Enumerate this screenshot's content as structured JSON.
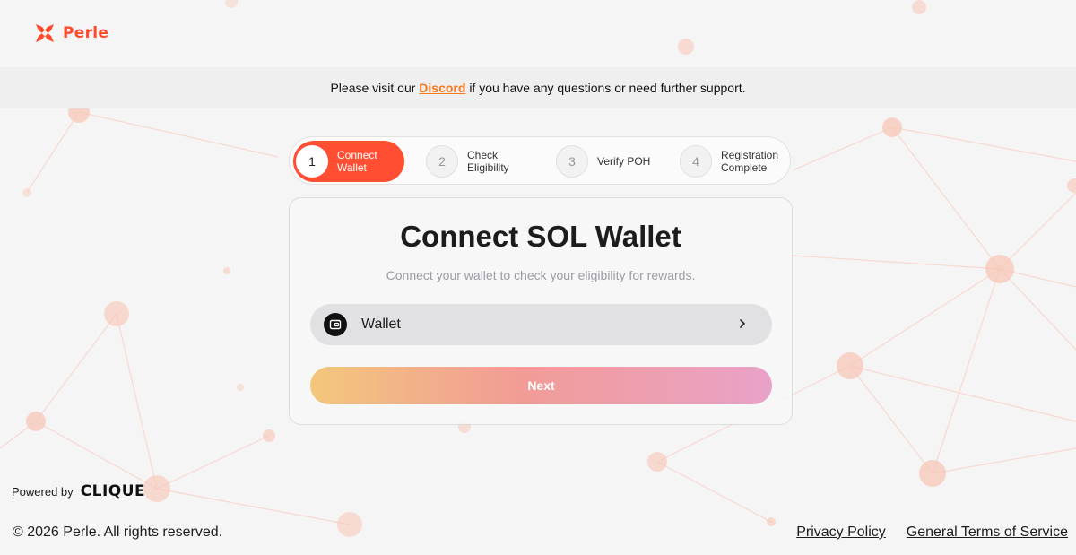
{
  "brand": {
    "name": "Perle",
    "color": "#ff4b2b"
  },
  "banner": {
    "prefix": "Please visit our",
    "link_label": "Discord",
    "suffix": "if you have any questions or need further support."
  },
  "steps": [
    {
      "number": "1",
      "label": "Connect\nWallet",
      "active": true
    },
    {
      "number": "2",
      "label": "Check\nEligibility",
      "active": false
    },
    {
      "number": "3",
      "label": "Verify POH",
      "active": false
    },
    {
      "number": "4",
      "label": "Registration\nComplete",
      "active": false
    }
  ],
  "card": {
    "title": "Connect SOL Wallet",
    "subtitle": "Connect your wallet to check your eligibility for rewards.",
    "wallet_label": "Wallet",
    "next_label": "Next"
  },
  "footer": {
    "powered_by": "Powered by",
    "partner": "CLIQUE",
    "copyright": "© 2026 Perle. All rights reserved.",
    "links": [
      "Privacy Policy",
      "General Terms of Service"
    ]
  },
  "icons": {
    "logo": "perle-logo-icon",
    "wallet": "wallet-icon",
    "chevron": "chevron-right-icon"
  },
  "colors": {
    "accent": "#ff4e31",
    "link": "#f4791f",
    "next_gradient": [
      "#f3c77c",
      "#f29c96",
      "#e9a2c8"
    ]
  }
}
